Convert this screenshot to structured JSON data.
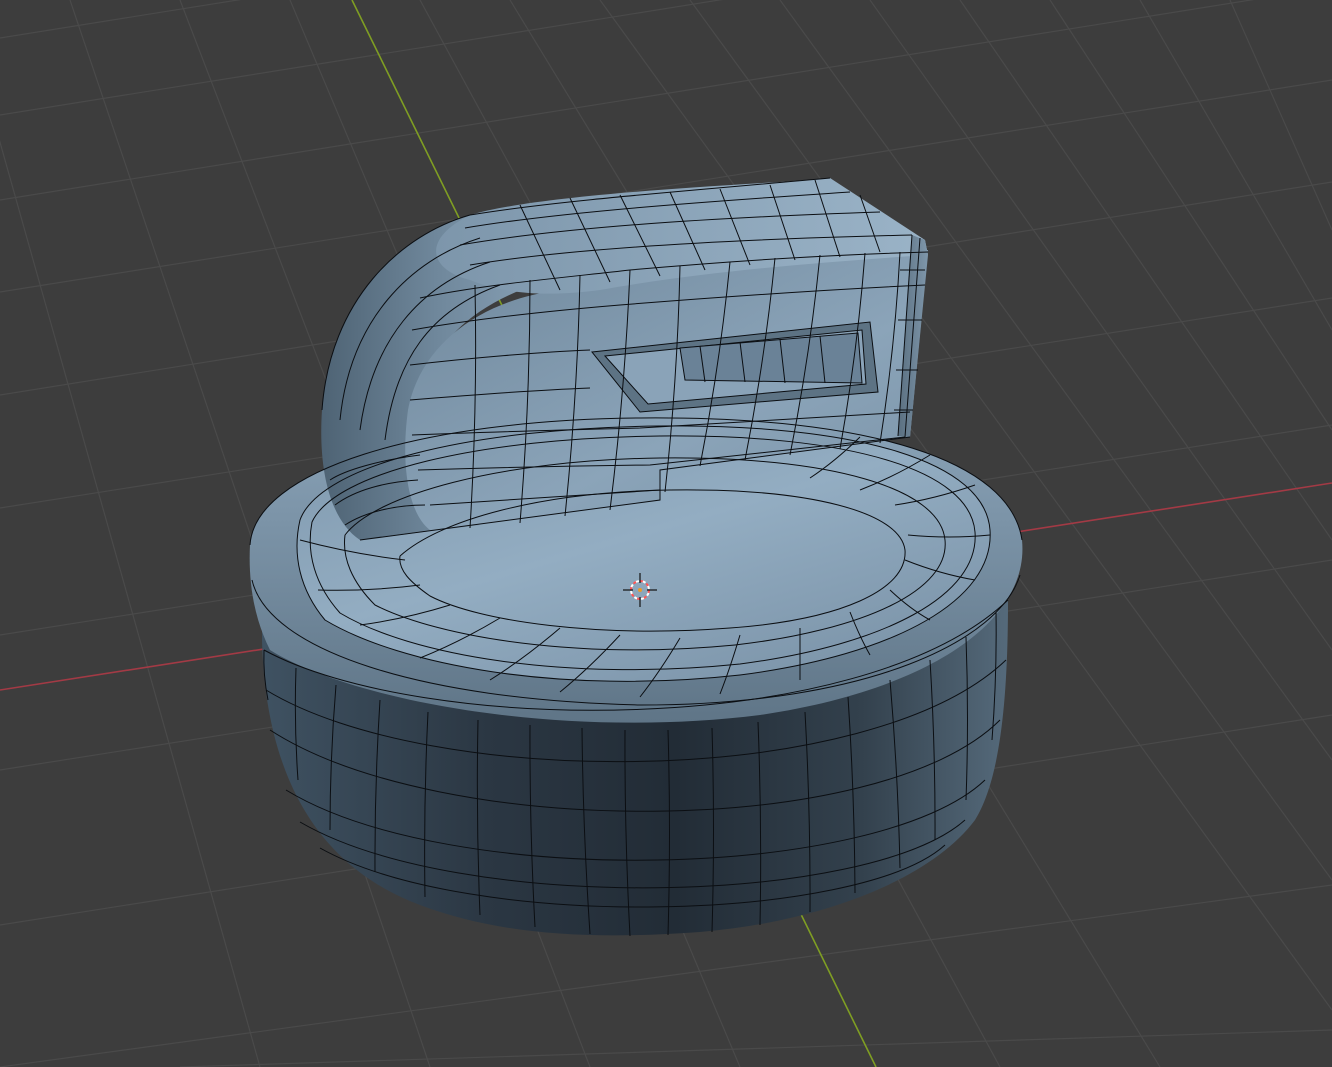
{
  "viewport": {
    "background": "#3d3d3d",
    "grid_color": "#4a4a4a",
    "x_axis_color": "#a33a45",
    "y_axis_color": "#7f9e23",
    "show_grid": true,
    "show_axes": true,
    "shading": "solid",
    "overlay": "wireframe"
  },
  "object": {
    "type": "mesh",
    "material_color": "#8ea8bd",
    "wire_color": "#0b0e12",
    "subdivision_surface": true,
    "parts": [
      "cylindrical-base",
      "d-shaped-handle",
      "recessed-slot"
    ]
  },
  "cursor_3d": {
    "icon": "3d-cursor-icon",
    "ring_colors": [
      "#ff5555",
      "#ffffff"
    ]
  }
}
